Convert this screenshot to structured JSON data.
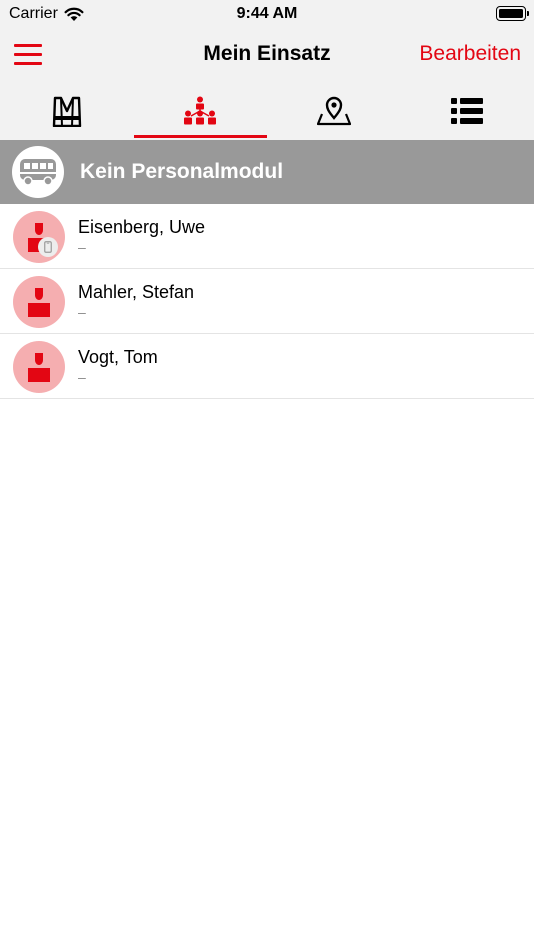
{
  "status_bar": {
    "carrier": "Carrier",
    "time": "9:44 AM",
    "wifi_icon": "wifi-icon",
    "battery_icon": "battery-full-icon"
  },
  "nav": {
    "title": "Mein Einsatz",
    "edit_label": "Bearbeiten",
    "menu_icon": "hamburger-menu-icon"
  },
  "tabs": [
    {
      "icon": "safety-vest-icon",
      "active": false
    },
    {
      "icon": "team-hierarchy-icon",
      "active": true
    },
    {
      "icon": "map-pin-icon",
      "active": false
    },
    {
      "icon": "list-icon",
      "active": false
    }
  ],
  "section": {
    "icon": "bus-icon",
    "title": "Kein Personalmodul"
  },
  "persons": [
    {
      "name": "Eisenberg, Uwe",
      "subtitle": "–",
      "device_badge": true
    },
    {
      "name": "Mahler, Stefan",
      "subtitle": "–",
      "device_badge": false
    },
    {
      "name": "Vogt, Tom",
      "subtitle": "–",
      "device_badge": false
    }
  ],
  "colors": {
    "accent": "#e30613",
    "bar_background": "#f2f2f2",
    "section_background": "#999999",
    "avatar_background": "#f5aeb0"
  }
}
